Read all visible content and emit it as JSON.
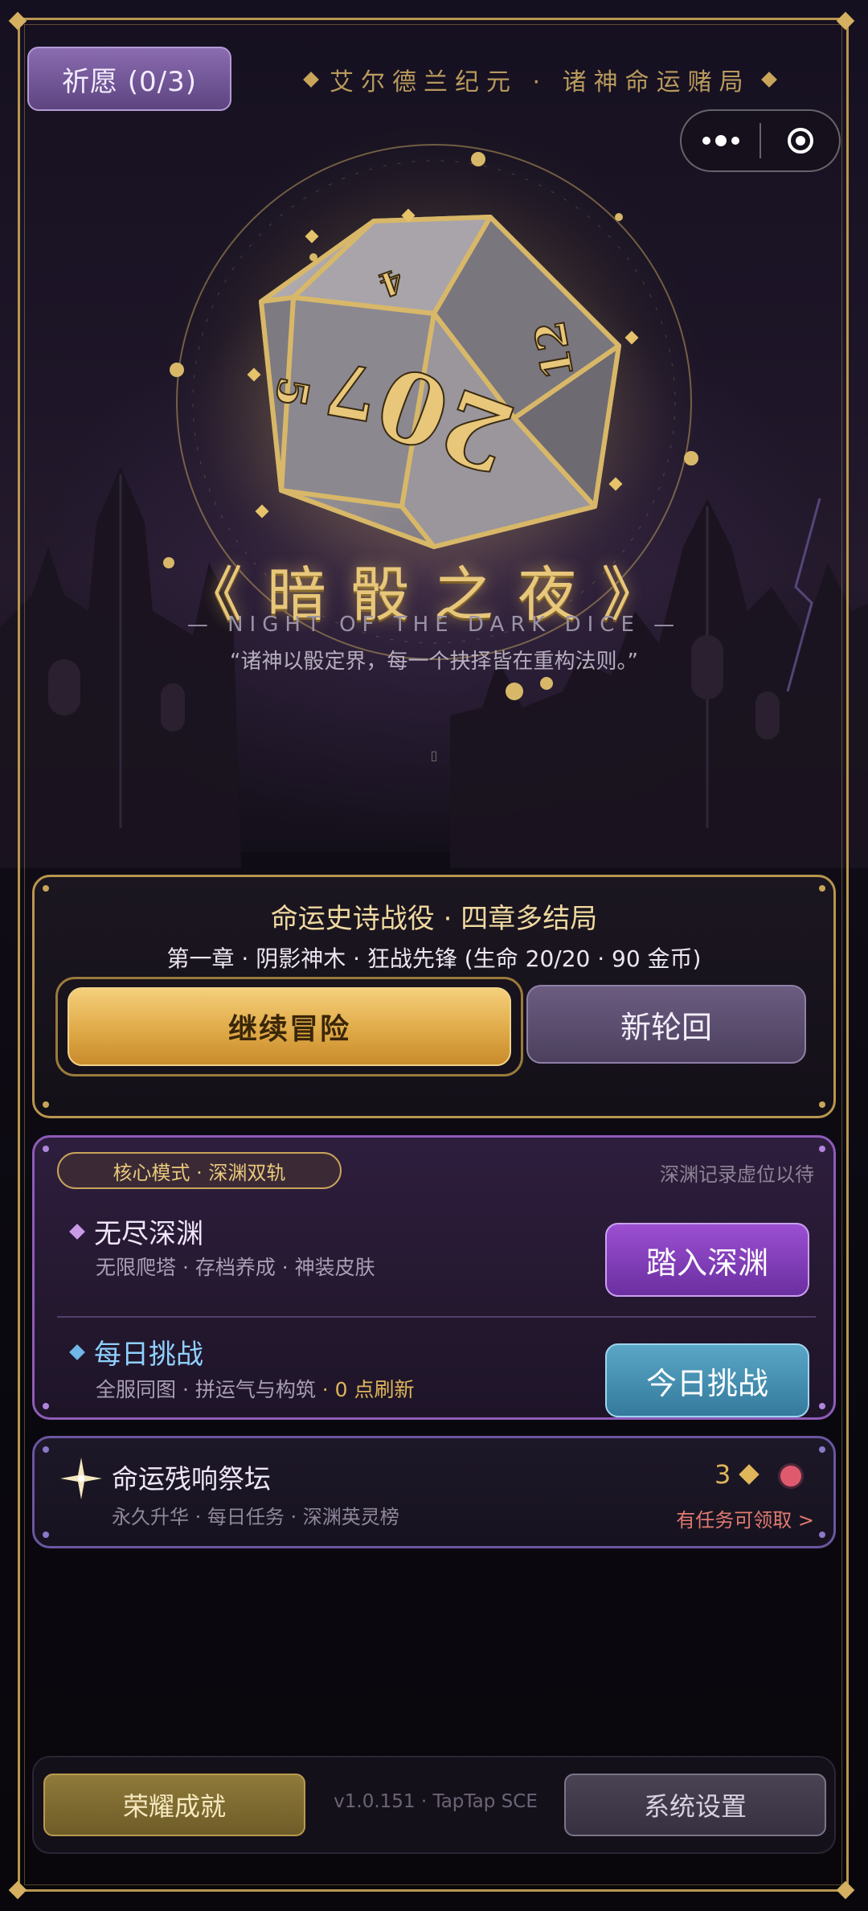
{
  "top_bar": {
    "pray_label": "祈愿 (0/3)",
    "era_text": "艾尔德兰纪元 · 诸神命运赌局"
  },
  "hero": {
    "title": "《暗骰之夜》",
    "subtitle": "— NIGHT OF THE DARK DICE —",
    "quote": "“诸神以骰定界，每一个抉择皆在重构法则。”",
    "dice_faces": [
      "4",
      "7",
      "20",
      "5",
      "12"
    ],
    "scroll_hint": "▯"
  },
  "campaign": {
    "title": "命运史诗战役 · 四章多结局",
    "detail": "第一章 · 阴影神木 · 狂战先锋 (生命 20/20 · 90 金币)",
    "continue_label": "继续冒险",
    "new_cycle_label": "新轮回"
  },
  "modes": {
    "tag": "核心模式 · 深渊双轨",
    "note": "深渊记录虚位以待",
    "abyss": {
      "name": "无尽深渊",
      "desc": "无限爬塔 · 存档养成 · 神装皮肤",
      "button": "踏入深渊"
    },
    "daily": {
      "name": "每日挑战",
      "desc": "全服同图 · 拼运气与构筑",
      "refresh": " · 0 点刷新",
      "button": "今日挑战"
    }
  },
  "altar": {
    "title": "命运残响祭坛",
    "desc": "永久升华 · 每日任务 · 深渊英灵榜",
    "count": "3",
    "claim": "有任务可领取 >"
  },
  "bottom": {
    "honor_label": "荣耀成就",
    "version": "v1.0.151 · TapTap SCE",
    "settings_label": "系统设置"
  },
  "colors": {
    "gold": "#c9a55a",
    "purple_accent": "#8e5cb8",
    "blue_accent": "#5aa6c6",
    "badge_red": "#e05a6e"
  },
  "icons": [
    "more-dots-icon",
    "close-target-icon",
    "sparkle-star-icon",
    "gold-diamond-icon",
    "d20-dice-icon"
  ]
}
